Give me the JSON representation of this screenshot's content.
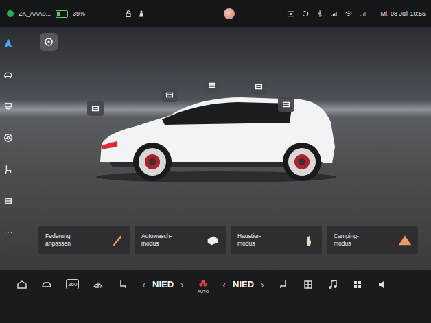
{
  "status_bar": {
    "network": "ZK_AAA0...",
    "battery": "39%",
    "battery_level": 0.39,
    "datetime": "Mi. 08 Juli 10:56"
  },
  "sidebar": {
    "items": [
      {
        "selected": true
      },
      {
        "selected": false
      },
      {
        "selected": false
      },
      {
        "selected": false
      },
      {
        "selected": false
      },
      {
        "selected": false
      },
      {
        "selected": false
      }
    ]
  },
  "cards": [
    {
      "label": "Federung\nanpassen"
    },
    {
      "label": "Autowasch-\nmodus"
    },
    {
      "label": "Haustier-\nmodus"
    },
    {
      "label": "Camping-\nmodus"
    }
  ],
  "bottom_bar": {
    "view_label": "360",
    "left_temp": {
      "prev": "‹",
      "value": "NIED",
      "next": "›"
    },
    "fan_mode": "AUTO",
    "right_temp": {
      "prev": "‹",
      "value": "NIED",
      "next": "›"
    }
  }
}
